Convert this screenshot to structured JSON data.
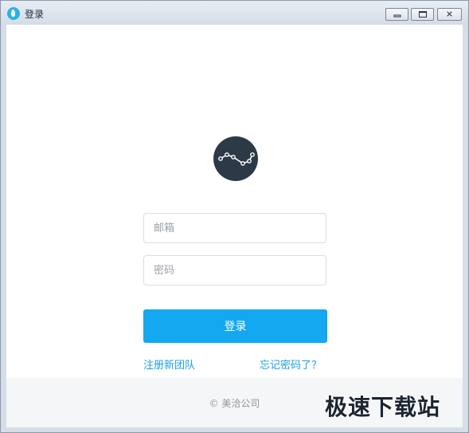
{
  "window": {
    "title": "登录",
    "close_glyph": "✕",
    "icon": "app-logo-icon"
  },
  "logo": {
    "icon": "line-chart-logo-icon",
    "bg_color": "#2c3a47"
  },
  "form": {
    "email_placeholder": "邮箱",
    "password_placeholder": "密码",
    "login_label": "登录",
    "register_label": "注册新团队",
    "forgot_label": "忘记密码了？"
  },
  "footer": {
    "copyright": "© 美洽公司"
  },
  "watermark": "极速下载站",
  "colors": {
    "accent": "#13a8f0",
    "link": "#1aa0e6"
  }
}
